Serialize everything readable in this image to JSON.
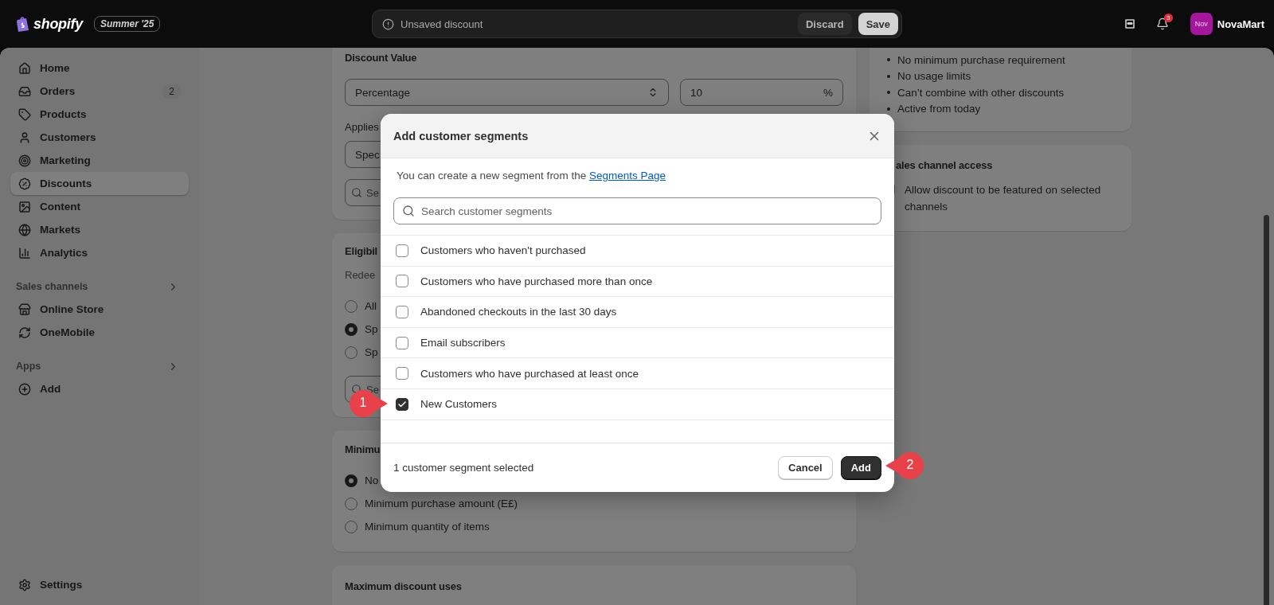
{
  "top_bar": {
    "logo": "shopify",
    "edition": "Summer '25",
    "save_bar": {
      "message": "Unsaved discount",
      "buttons": [
        {
          "label": "Discard",
          "kind": "secondary"
        },
        {
          "label": "Save",
          "kind": "primary"
        }
      ]
    },
    "notification_count": "3",
    "avatar": "Nov",
    "store_name": "NovaMart"
  },
  "sidebar": {
    "items": [
      {
        "label": "Home",
        "selected": false
      },
      {
        "label": "Orders",
        "selected": false,
        "count": "2"
      },
      {
        "label": "Products",
        "selected": false
      },
      {
        "label": "Customers",
        "selected": false
      },
      {
        "label": "Marketing",
        "selected": false
      },
      {
        "label": "Discounts",
        "selected": true
      },
      {
        "label": "Content",
        "selected": false
      },
      {
        "label": "Markets",
        "selected": false
      },
      {
        "label": "Analytics",
        "selected": false
      }
    ],
    "sections": [
      {
        "title": "Sales channels",
        "items": [
          {
            "label": "Online Store",
            "selected": false
          },
          {
            "label": "OneMobile",
            "selected": false
          }
        ]
      },
      {
        "title": "Apps",
        "items": [
          {
            "label": "Add",
            "selected": false
          }
        ]
      }
    ],
    "footer_item": {
      "label": "Settings"
    }
  },
  "discount_value_card": {
    "title": "Discount Value",
    "type_select": "Percentage",
    "value": "10",
    "suffix": "%",
    "applies_label": "Applies",
    "applies_select": "Spec",
    "search_placeholder": "Se"
  },
  "eligibility_card": {
    "title": "Eligibil",
    "subtitle": "Redee",
    "options": [
      {
        "label": "All",
        "selected": false
      },
      {
        "label": "Sp",
        "selected": true
      },
      {
        "label": "Sp",
        "selected": false
      }
    ],
    "search_placeholder": "Se"
  },
  "minimum_card": {
    "title": "Minimu",
    "options": [
      {
        "label": "No",
        "selected": true
      },
      {
        "label": "Minimum purchase amount (E£)",
        "selected": false
      },
      {
        "label": "Minimum quantity of items",
        "selected": false
      }
    ]
  },
  "max_uses_card": {
    "title": "Maximum discount uses"
  },
  "summary_card": {
    "items": [
      "No minimum purchase requirement",
      "No usage limits",
      "Can’t combine with other discounts",
      "Active from today"
    ]
  },
  "sales_channel_card": {
    "title": "ales channel access",
    "checkbox": {
      "label": "Allow discount to be featured on selected channels",
      "checked": false
    }
  },
  "modal": {
    "title": "Add customer segments",
    "info": "You can create a new segment from the ",
    "link": "Segments Page",
    "search_placeholder": "Search customer segments",
    "segments": [
      {
        "label": "Customers who haven't purchased",
        "checked": false
      },
      {
        "label": "Customers who have purchased more than once",
        "checked": false
      },
      {
        "label": "Abandoned checkouts in the last 30 days",
        "checked": false
      },
      {
        "label": "Email subscribers",
        "checked": false
      },
      {
        "label": "Customers who have purchased at least once",
        "checked": false
      },
      {
        "label": "New Customers",
        "checked": true
      }
    ],
    "footer_text": "1 customer segment selected",
    "buttons": [
      {
        "label": "Cancel",
        "kind": "secondary"
      },
      {
        "label": "Add",
        "kind": "primary"
      }
    ]
  },
  "annotations": [
    {
      "label": "1"
    },
    {
      "label": "2"
    }
  ]
}
